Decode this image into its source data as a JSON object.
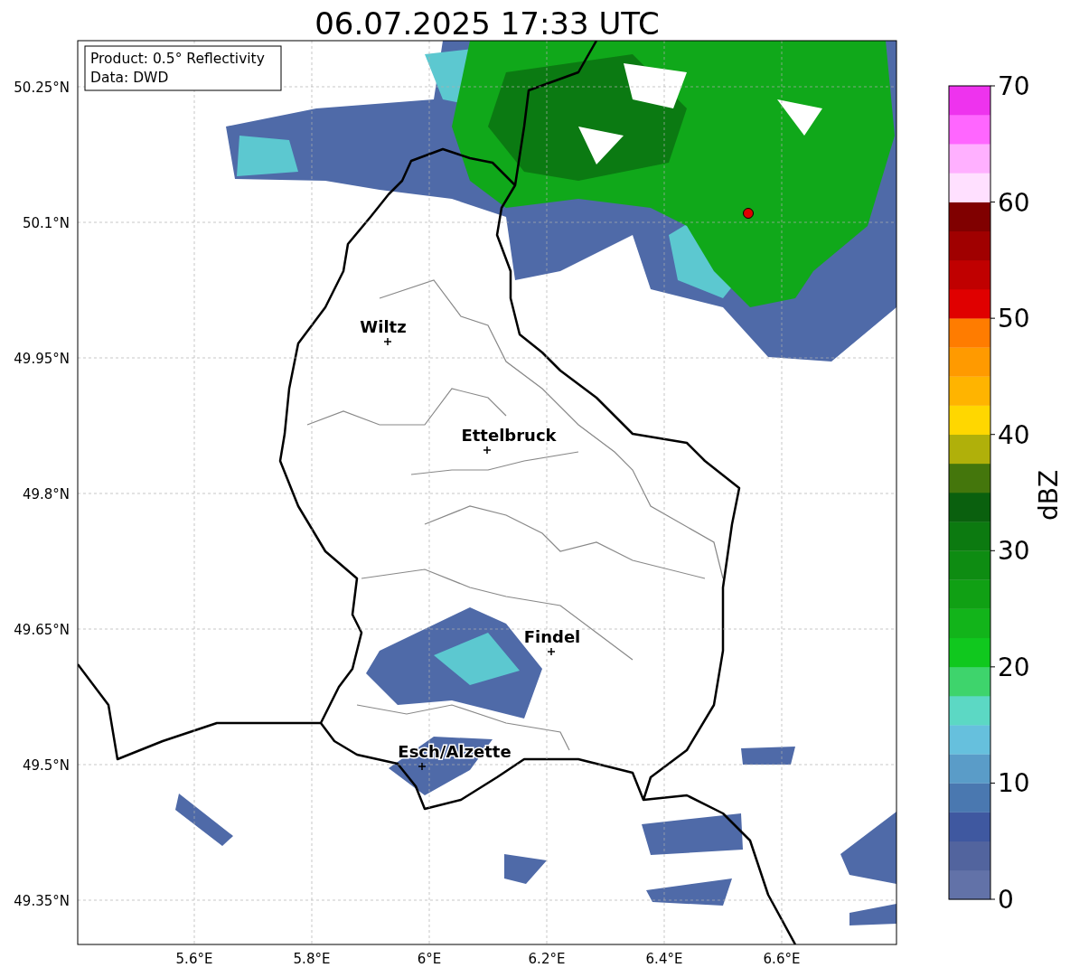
{
  "title": "06.07.2025 17:33 UTC",
  "info_box": [
    "Product: 0.5° Reflectivity",
    "Data: DWD"
  ],
  "map": {
    "y_axis_labels": [
      "50.25°N",
      "50.1°N",
      "49.95°N",
      "49.8°N",
      "49.65°N",
      "49.5°N",
      "49.35°N"
    ],
    "x_axis_labels": [
      "5.6°E",
      "5.8°E",
      "6°E",
      "6.2°E",
      "6.4°E",
      "6.6°E"
    ],
    "cities": [
      {
        "name": "Wiltz"
      },
      {
        "name": "Ettelbruck"
      },
      {
        "name": "Findel"
      },
      {
        "name": "Esch/Alzette"
      }
    ]
  },
  "colorbar": {
    "label": "dBZ",
    "ticks": [
      "70",
      "60",
      "50",
      "40",
      "30",
      "20",
      "10",
      "0"
    ],
    "segments": [
      {
        "color": "#6272a8"
      },
      {
        "color": "#52649e"
      },
      {
        "color": "#3f58a0"
      },
      {
        "color": "#4a78b0"
      },
      {
        "color": "#5a9cc8"
      },
      {
        "color": "#66c0dd"
      },
      {
        "color": "#5cd8c4"
      },
      {
        "color": "#3ed46c"
      },
      {
        "color": "#10c81e"
      },
      {
        "color": "#12b41a"
      },
      {
        "color": "#10a014"
      },
      {
        "color": "#0e8c12"
      },
      {
        "color": "#0c7a10"
      },
      {
        "color": "#0a600e"
      },
      {
        "color": "#44760c"
      },
      {
        "color": "#b0b00a"
      },
      {
        "color": "#ffd700"
      },
      {
        "color": "#ffb400"
      },
      {
        "color": "#ff9a00"
      },
      {
        "color": "#ff7c00"
      },
      {
        "color": "#e00000"
      },
      {
        "color": "#c00000"
      },
      {
        "color": "#a00000"
      },
      {
        "color": "#800000"
      },
      {
        "color": "#ffe0ff"
      },
      {
        "color": "#ffb0ff"
      },
      {
        "color": "#ff66ff"
      },
      {
        "color": "#ee33ee"
      }
    ]
  }
}
